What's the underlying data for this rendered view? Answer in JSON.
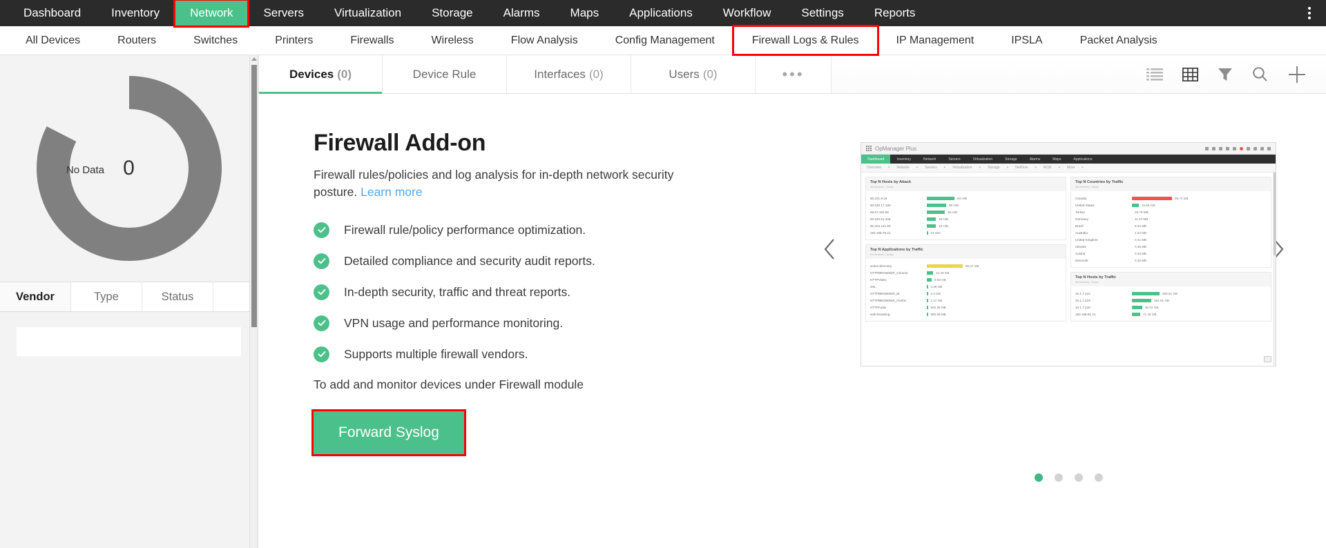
{
  "topnav": {
    "items": [
      {
        "label": "Dashboard",
        "active": false
      },
      {
        "label": "Inventory",
        "active": false
      },
      {
        "label": "Network",
        "active": true
      },
      {
        "label": "Servers",
        "active": false
      },
      {
        "label": "Virtualization",
        "active": false
      },
      {
        "label": "Storage",
        "active": false
      },
      {
        "label": "Alarms",
        "active": false
      },
      {
        "label": "Maps",
        "active": false
      },
      {
        "label": "Applications",
        "active": false
      },
      {
        "label": "Workflow",
        "active": false
      },
      {
        "label": "Settings",
        "active": false
      },
      {
        "label": "Reports",
        "active": false
      }
    ],
    "kebab_icon": "vertical-dots-icon"
  },
  "subnav": {
    "items": [
      {
        "label": "All Devices",
        "highlight": false
      },
      {
        "label": "Routers",
        "highlight": false
      },
      {
        "label": "Switches",
        "highlight": false
      },
      {
        "label": "Printers",
        "highlight": false
      },
      {
        "label": "Firewalls",
        "highlight": false
      },
      {
        "label": "Wireless",
        "highlight": false
      },
      {
        "label": "Flow Analysis",
        "highlight": false
      },
      {
        "label": "Config Management",
        "highlight": false
      },
      {
        "label": "Firewall Logs & Rules",
        "highlight": true
      },
      {
        "label": "IP Management",
        "highlight": false
      },
      {
        "label": "IPSLA",
        "highlight": false
      },
      {
        "label": "Packet Analysis",
        "highlight": false
      }
    ]
  },
  "sidebar": {
    "donut": {
      "no_data_label": "No Data",
      "center_value": "0",
      "arc_color": "#808080",
      "track_color": "#f3f3f3"
    },
    "tabs": [
      {
        "label": "Vendor",
        "active": true
      },
      {
        "label": "Type",
        "active": false
      },
      {
        "label": "Status",
        "active": false
      }
    ]
  },
  "tabbar": {
    "tabs": [
      {
        "label": "Devices",
        "count": "(0)",
        "active": true
      },
      {
        "label": "Device Rule",
        "count": "",
        "active": false
      },
      {
        "label": "Interfaces",
        "count": "(0)",
        "active": false
      },
      {
        "label": "Users",
        "count": "(0)",
        "active": false
      },
      {
        "label": "•••",
        "count": "",
        "active": false,
        "is_more": true
      }
    ],
    "icons": [
      {
        "name": "list-view-icon",
        "active": false
      },
      {
        "name": "grid-view-icon",
        "active": true
      },
      {
        "name": "filter-icon",
        "active": false
      },
      {
        "name": "search-icon",
        "active": false
      },
      {
        "name": "add-icon",
        "active": false
      }
    ]
  },
  "promo": {
    "title": "Firewall Add-on",
    "subtitle": "Firewall rules/policies and log analysis for in-depth network security posture.",
    "learn_more": "Learn more",
    "features": [
      "Firewall rule/policy performance optimization.",
      "Detailed compliance and security audit reports.",
      "In-depth security, traffic and threat reports.",
      "VPN usage and performance monitoring.",
      "Supports multiple firewall vendors."
    ],
    "note": "To add and monitor devices under Firewall module",
    "cta_label": "Forward Syslog",
    "accent_color": "#4cc08a",
    "highlight_color": "#ff0000"
  },
  "carousel": {
    "prev_icon": "chevron-left-icon",
    "next_icon": "chevron-right-icon",
    "dots": [
      {
        "active": true
      },
      {
        "active": false
      },
      {
        "active": false
      },
      {
        "active": false
      }
    ],
    "preview": {
      "brand": "OpManager Plus",
      "nav": [
        "Dashboard",
        "Inventory",
        "Network",
        "Servers",
        "Virtualization",
        "Storage",
        "Alarms",
        "Maps",
        "Applications"
      ],
      "subnav": [
        "Overview",
        "Network",
        "Servers",
        "Virtualization",
        "Storage",
        "NetFlow",
        "NCM",
        "More"
      ],
      "widgets": [
        {
          "title": "Top N Hosts by Attack",
          "subtitle": "All Devices | Today",
          "rows": [
            {
              "name": "50.221.9.15",
              "value": "54 Hits",
              "bar": 40,
              "color": "green"
            },
            {
              "name": "50.220.17.190",
              "value": "38 Hits",
              "bar": 28,
              "color": "green"
            },
            {
              "name": "68.67.152.58",
              "value": "36 Hits",
              "bar": 26,
              "color": "green"
            },
            {
              "name": "50.220.51.436",
              "value": "18 Hits",
              "bar": 13,
              "color": "green"
            },
            {
              "name": "50.204.121.80",
              "value": "18 Hits",
              "bar": 13,
              "color": "green"
            },
            {
              "name": "192.168.79.41",
              "value": "21 Hits",
              "bar": 1.5,
              "color": "thin"
            }
          ]
        },
        {
          "title": "Top N Applications by Traffic",
          "subtitle": "All Devices | Today",
          "rows": [
            {
              "name": "active-directory",
              "value": "98.47 GB",
              "bar": 52,
              "color": "yellow"
            },
            {
              "name": "HTTPBROWSER_Chrome",
              "value": "12.49 GB",
              "bar": 9,
              "color": "green"
            },
            {
              "name": "HTTPVideo",
              "value": "9.93 GB",
              "bar": 7,
              "color": "green"
            },
            {
              "name": "SSL",
              "value": "3.29 GB",
              "bar": 1.5,
              "color": "thin"
            },
            {
              "name": "HTTPBROWSER_IE",
              "value": "2.3 GB",
              "bar": 1.5,
              "color": "thin"
            },
            {
              "name": "HTTPBROWSER_Firefox",
              "value": "1.17 GB",
              "bar": 1.5,
              "color": "thin"
            },
            {
              "name": "HTTPAudio",
              "value": "945.35 MB",
              "bar": 1.5,
              "color": "thin"
            },
            {
              "name": "web-browsing",
              "value": "890.08 MB",
              "bar": 1.5,
              "color": "thin"
            }
          ]
        },
        {
          "title": "Top N Countries by Traffic",
          "subtitle": "All Devices | Today",
          "rows": [
            {
              "name": "Canada",
              "value": "95.72 GB",
              "bar": 58,
              "color": "red"
            },
            {
              "name": "United States",
              "value": "15.56 GB",
              "bar": 10,
              "color": "green"
            },
            {
              "name": "Turkey",
              "value": "29.79 MB",
              "bar": 0,
              "color": "none"
            },
            {
              "name": "Germany",
              "value": "11.44 MB",
              "bar": 0,
              "color": "none"
            },
            {
              "name": "Brazil",
              "value": "6.94 MB",
              "bar": 0,
              "color": "none"
            },
            {
              "name": "Australia",
              "value": "4.54 MB",
              "bar": 0,
              "color": "none"
            },
            {
              "name": "United Kingdom",
              "value": "0.41 MB",
              "bar": 0,
              "color": "none"
            },
            {
              "name": "Ukraine",
              "value": "0.39 MB",
              "bar": 0,
              "color": "none"
            },
            {
              "name": "Austria",
              "value": "0.33 MB",
              "bar": 0,
              "color": "none"
            },
            {
              "name": "Denmark",
              "value": "0.32 MB",
              "bar": 0,
              "color": "none"
            }
          ]
        },
        {
          "title": "Top N Hosts by Traffic",
          "subtitle": "All Devices | Today",
          "rows": [
            {
              "name": "10.1.7.212",
              "value": "260.51 GB",
              "bar": 40,
              "color": "green"
            },
            {
              "name": "10.1.7.223",
              "value": "181.61 GB",
              "bar": 28,
              "color": "green"
            },
            {
              "name": "10.1.7.216",
              "value": "92.02 GB",
              "bar": 15,
              "color": "green"
            },
            {
              "name": "192.168.51.31",
              "value": "71.48 GB",
              "bar": 12,
              "color": "green"
            }
          ]
        }
      ]
    }
  }
}
